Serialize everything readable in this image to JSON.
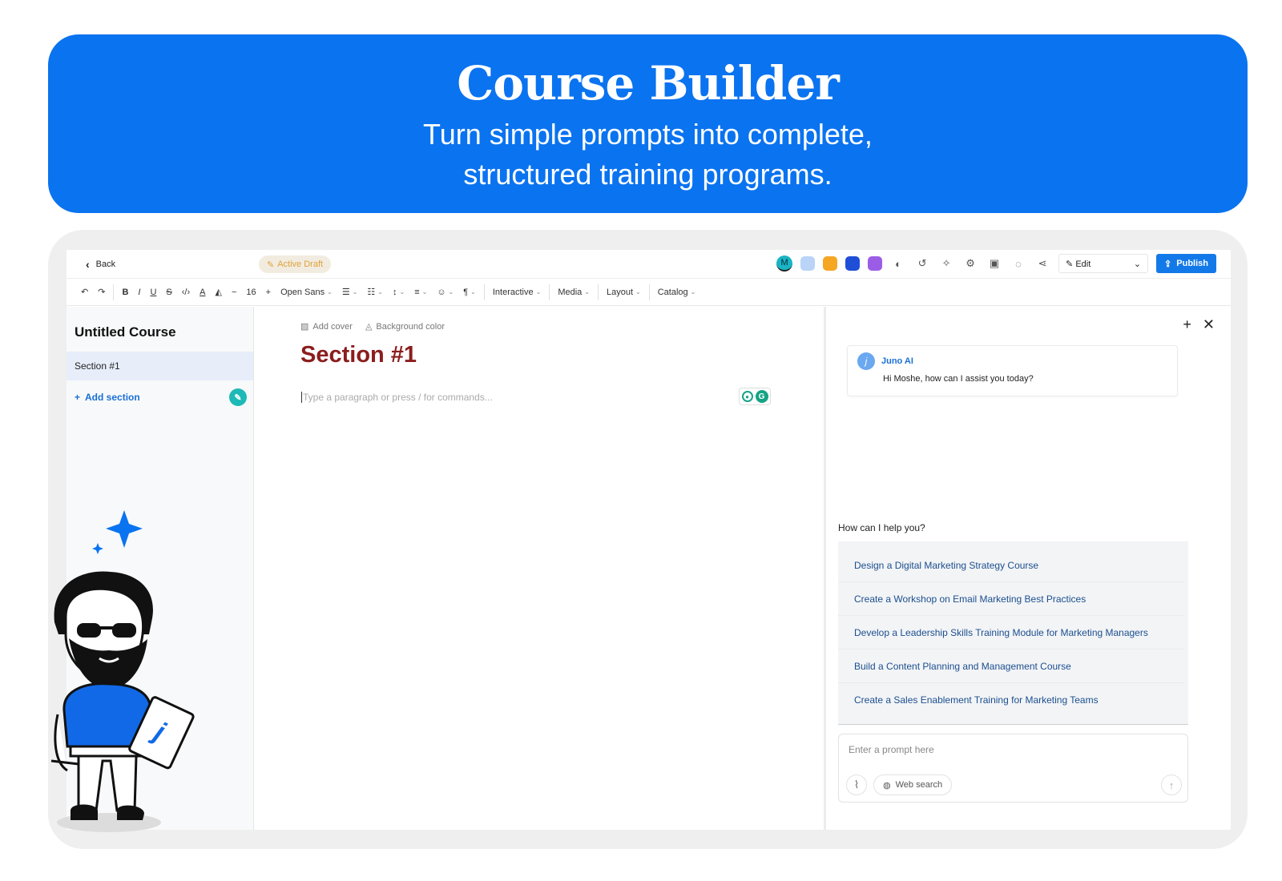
{
  "hero": {
    "title": "Course Builder",
    "subtitle_line1": "Turn simple prompts into complete,",
    "subtitle_line2": "structured training programs.",
    "color": "#0a73f0"
  },
  "topbar": {
    "back_label": "Back",
    "draft_label": "Active Draft",
    "avatar_letter": "M",
    "color_swatches": [
      "#b9d4f7",
      "#f5a623",
      "#1f4fd6",
      "#9b5de5"
    ],
    "edit_label": "Edit",
    "publish_label": "Publish"
  },
  "toolbar": {
    "font_size": "16",
    "font_family": "Open Sans",
    "menus": [
      "Interactive",
      "Media",
      "Layout",
      "Catalog"
    ]
  },
  "sidebar": {
    "course_title": "Untitled Course",
    "sections": [
      "Section #1"
    ],
    "add_section_label": "Add section"
  },
  "editor": {
    "add_cover_label": "Add cover",
    "background_color_label": "Background color",
    "section_heading": "Section #1",
    "placeholder": "Type a paragraph or press / for commands..."
  },
  "ai_panel": {
    "assistant_name": "Juno AI",
    "greeting": "Hi Moshe, how can I assist you today?",
    "help_label": "How can I help you?",
    "suggestions": [
      "Design a Digital Marketing Strategy Course",
      "Create a Workshop on Email Marketing Best Practices",
      "Develop a Leadership Skills Training Module for Marketing Managers",
      "Build a Content Planning and Management Course",
      "Create a Sales Enablement Training for Marketing Teams"
    ],
    "prompt_placeholder": "Enter a prompt here",
    "web_search_label": "Web search"
  }
}
